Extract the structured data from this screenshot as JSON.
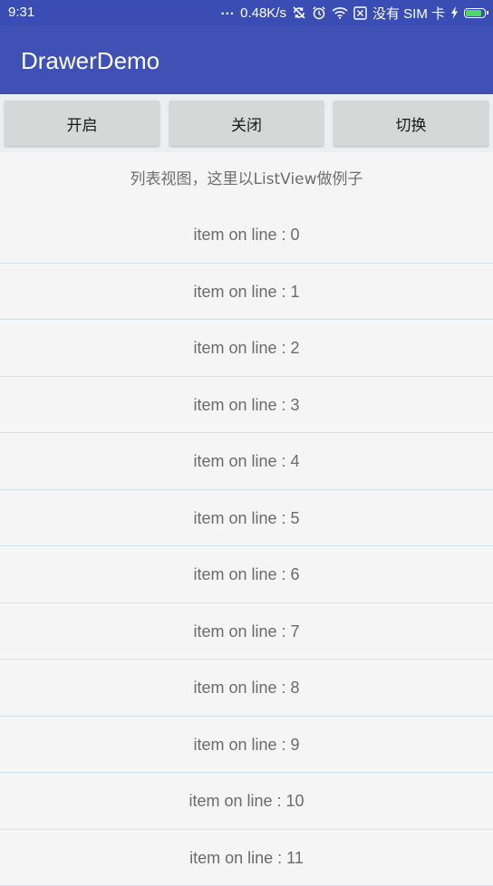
{
  "status_bar": {
    "time": "9:31",
    "dots": "...",
    "speed": "0.48K/s",
    "sim_text": "没有 SIM 卡",
    "battery_level": 0.85,
    "battery_color": "#4cd964"
  },
  "app_bar": {
    "title": "DrawerDemo",
    "color": "#3f51b5"
  },
  "buttons": {
    "open_label": "开启",
    "close_label": "关闭",
    "toggle_label": "切换"
  },
  "list": {
    "header": "列表视图，这里以ListView做例子",
    "items": [
      "item on line : 0",
      "item on line : 1",
      "item on line : 2",
      "item on line : 3",
      "item on line : 4",
      "item on line : 5",
      "item on line : 6",
      "item on line : 7",
      "item on line : 8",
      "item on line : 9",
      "item on line : 10",
      "item on line : 11"
    ]
  },
  "icons": {
    "status": [
      "sync-disabled-icon",
      "alarm-icon",
      "wifi-icon",
      "no-sim-icon",
      "charging-icon",
      "battery-icon"
    ]
  }
}
